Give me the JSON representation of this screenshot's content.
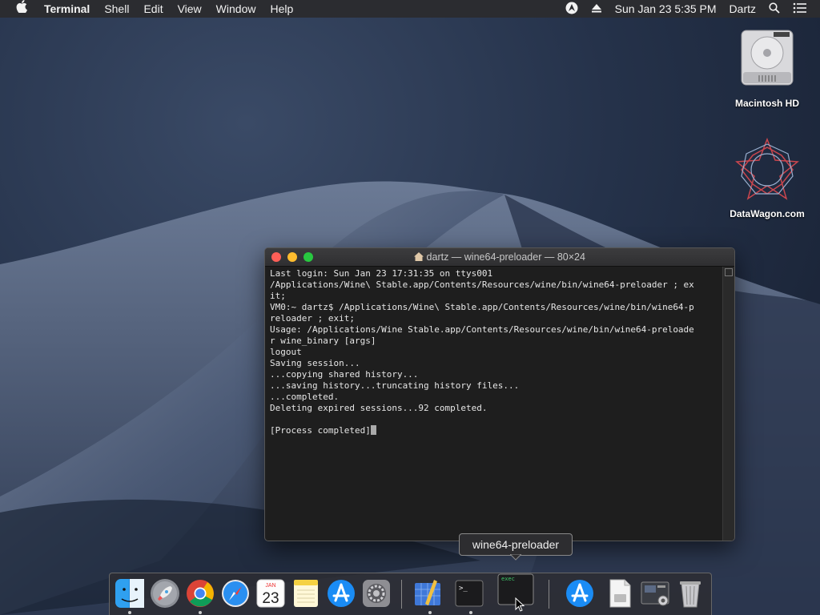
{
  "menubar": {
    "app": "Terminal",
    "menus": [
      "Shell",
      "Edit",
      "View",
      "Window",
      "Help"
    ],
    "datetime": "Sun Jan 23  5:35 PM",
    "user": "Dartz"
  },
  "desktop_icons": [
    {
      "label": "Macintosh HD",
      "icon": "hard-drive-icon"
    },
    {
      "label": "DataWagon.com",
      "icon": "star-polygon-icon"
    }
  ],
  "terminal": {
    "title": "dartz — wine64-preloader — 80×24",
    "lines": [
      "Last login: Sun Jan 23 17:31:35 on ttys001",
      "/Applications/Wine\\ Stable.app/Contents/Resources/wine/bin/wine64-preloader ; ex",
      "it;",
      "VM0:~ dartz$ /Applications/Wine\\ Stable.app/Contents/Resources/wine/bin/wine64-p",
      "reloader ; exit;",
      "Usage: /Applications/Wine Stable.app/Contents/Resources/wine/bin/wine64-preloade",
      "r wine_binary [args]",
      "logout",
      "Saving session...",
      "...copying shared history...",
      "...saving history...truncating history files...",
      "...completed.",
      "Deleting expired sessions...92 completed.",
      "",
      "[Process completed]"
    ]
  },
  "tooltip": "wine64-preloader",
  "dock": {
    "items": [
      {
        "name": "finder",
        "icon": "finder-icon"
      },
      {
        "name": "launchpad",
        "icon": "rocket-icon"
      },
      {
        "name": "chrome",
        "icon": "chrome-icon"
      },
      {
        "name": "safari",
        "icon": "compass-icon"
      },
      {
        "name": "calendar",
        "icon": "calendar-icon",
        "month": "JAN",
        "day": "23"
      },
      {
        "name": "notes",
        "icon": "notes-icon"
      },
      {
        "name": "app-store",
        "icon": "app-store-icon"
      },
      {
        "name": "system-preferences",
        "icon": "gear-icon"
      },
      {
        "name": "xcode-like",
        "icon": "blueprint-icon"
      },
      {
        "name": "terminal",
        "icon": "terminal-icon",
        "label": ">_"
      },
      {
        "name": "exec",
        "icon": "exec-icon",
        "label": "exec"
      },
      {
        "name": "app-store-2",
        "icon": "app-store-icon"
      },
      {
        "name": "preview-doc",
        "icon": "document-icon"
      },
      {
        "name": "screenshot",
        "icon": "screenshot-icon"
      },
      {
        "name": "trash",
        "icon": "trash-icon"
      }
    ]
  }
}
